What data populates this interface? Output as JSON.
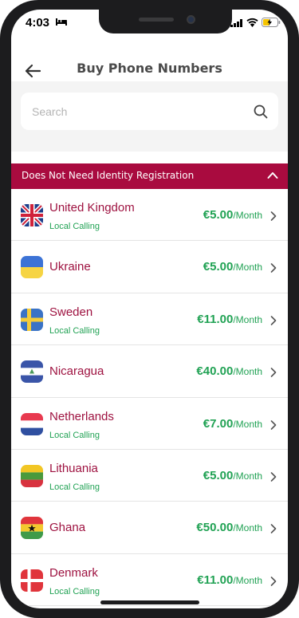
{
  "status": {
    "time": "4:03"
  },
  "header": {
    "title": "Buy Phone Numbers"
  },
  "search": {
    "placeholder": "Search"
  },
  "section": {
    "title": "Does Not Need Identity Registration"
  },
  "countries": [
    {
      "name": "United Kingdom",
      "sub": "Local Calling",
      "price": "€5.00",
      "unit": "/Month",
      "flag_icon": "uk-flag-icon"
    },
    {
      "name": "Ukraine",
      "sub": "",
      "price": "€5.00",
      "unit": "/Month",
      "flag_icon": "ukraine-flag-icon"
    },
    {
      "name": "Sweden",
      "sub": "Local Calling",
      "price": "€11.00",
      "unit": "/Month",
      "flag_icon": "sweden-flag-icon"
    },
    {
      "name": "Nicaragua",
      "sub": "",
      "price": "€40.00",
      "unit": "/Month",
      "flag_icon": "nicaragua-flag-icon"
    },
    {
      "name": "Netherlands",
      "sub": "Local Calling",
      "price": "€7.00",
      "unit": "/Month",
      "flag_icon": "netherlands-flag-icon"
    },
    {
      "name": "Lithuania",
      "sub": "Local Calling",
      "price": "€5.00",
      "unit": "/Month",
      "flag_icon": "lithuania-flag-icon"
    },
    {
      "name": "Ghana",
      "sub": "",
      "price": "€50.00",
      "unit": "/Month",
      "flag_icon": "ghana-flag-icon"
    },
    {
      "name": "Denmark",
      "sub": "Local Calling",
      "price": "€11.00",
      "unit": "/Month",
      "flag_icon": "denmark-flag-icon"
    }
  ],
  "colors": {
    "accent": "#a90b3f",
    "country_text": "#9e1240",
    "price_green": "#21a254",
    "search_bg": "#f4f4f4"
  }
}
